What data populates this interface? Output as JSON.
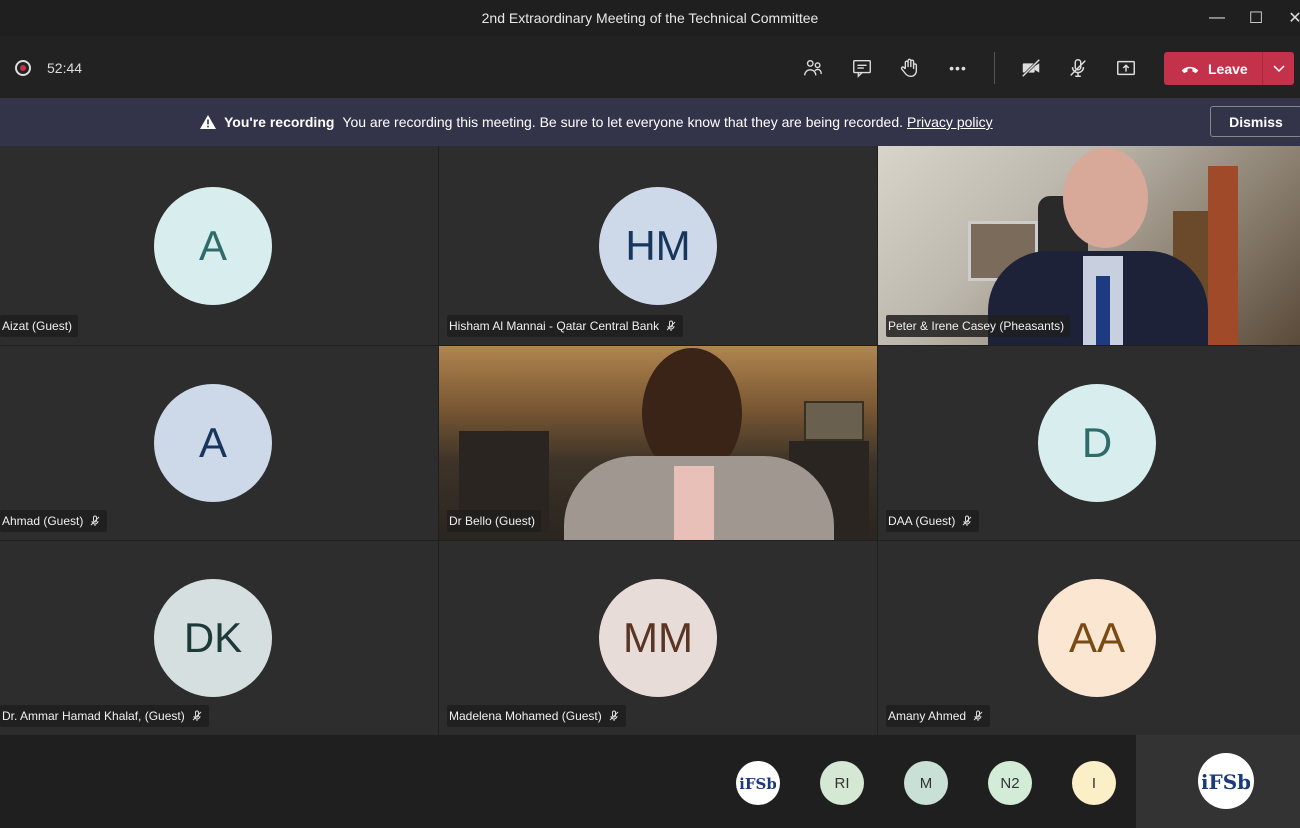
{
  "window": {
    "title": "2nd Extraordinary Meeting of the Technical Committee",
    "minimize": "—",
    "maximize": "☐",
    "close": "✕"
  },
  "toolbar": {
    "timer": "52:44",
    "leave_label": "Leave",
    "more_label": "•••"
  },
  "banner": {
    "heading": "You're recording",
    "message": "You are recording this meeting. Be sure to let everyone know that they are being recorded.",
    "link": "Privacy policy",
    "dismiss": "Dismiss"
  },
  "tiles": [
    {
      "name": "Aizat (Guest)",
      "initials": "A",
      "muted": false,
      "bg": "#d8eeee",
      "fg": "#2e6b6a"
    },
    {
      "name": "Hisham Al Mannai - Qatar Central Bank",
      "initials": "HM",
      "muted": true,
      "bg": "#cdd8e8",
      "fg": "#17365d"
    },
    {
      "name": "Peter & Irene Casey (Pheasants)",
      "initials": "",
      "muted": false,
      "video": true
    },
    {
      "name": "Ahmad (Guest)",
      "initials": "A",
      "muted": true,
      "bg": "#cdd8e8",
      "fg": "#17365d"
    },
    {
      "name": "Dr Bello (Guest)",
      "initials": "",
      "muted": false,
      "video": true
    },
    {
      "name": "DAA (Guest)",
      "initials": "D",
      "muted": true,
      "bg": "#d8eeee",
      "fg": "#2e6b6a"
    },
    {
      "name": "Dr. Ammar Hamad Khalaf, (Guest)",
      "initials": "DK",
      "muted": true,
      "bg": "#d6dfe0",
      "fg": "#1c3a3a"
    },
    {
      "name": "Madelena Mohamed (Guest)",
      "initials": "MM",
      "muted": true,
      "bg": "#e8dcd8",
      "fg": "#5a3524"
    },
    {
      "name": "Amany Ahmed",
      "initials": "AA",
      "muted": true,
      "bg": "#fbe6d2",
      "fg": "#7a4a14"
    }
  ],
  "overflow": [
    {
      "initials": "IFSB",
      "logo": true,
      "bg": "#ffffff"
    },
    {
      "initials": "RI",
      "bg": "#d5e8d4"
    },
    {
      "initials": "M",
      "bg": "#c8e0d6"
    },
    {
      "initials": "N2",
      "bg": "#d2ecd8"
    },
    {
      "initials": "I",
      "bg": "#fbefc8"
    }
  ],
  "self_view": {
    "initials": "IFSB",
    "logo": true
  }
}
